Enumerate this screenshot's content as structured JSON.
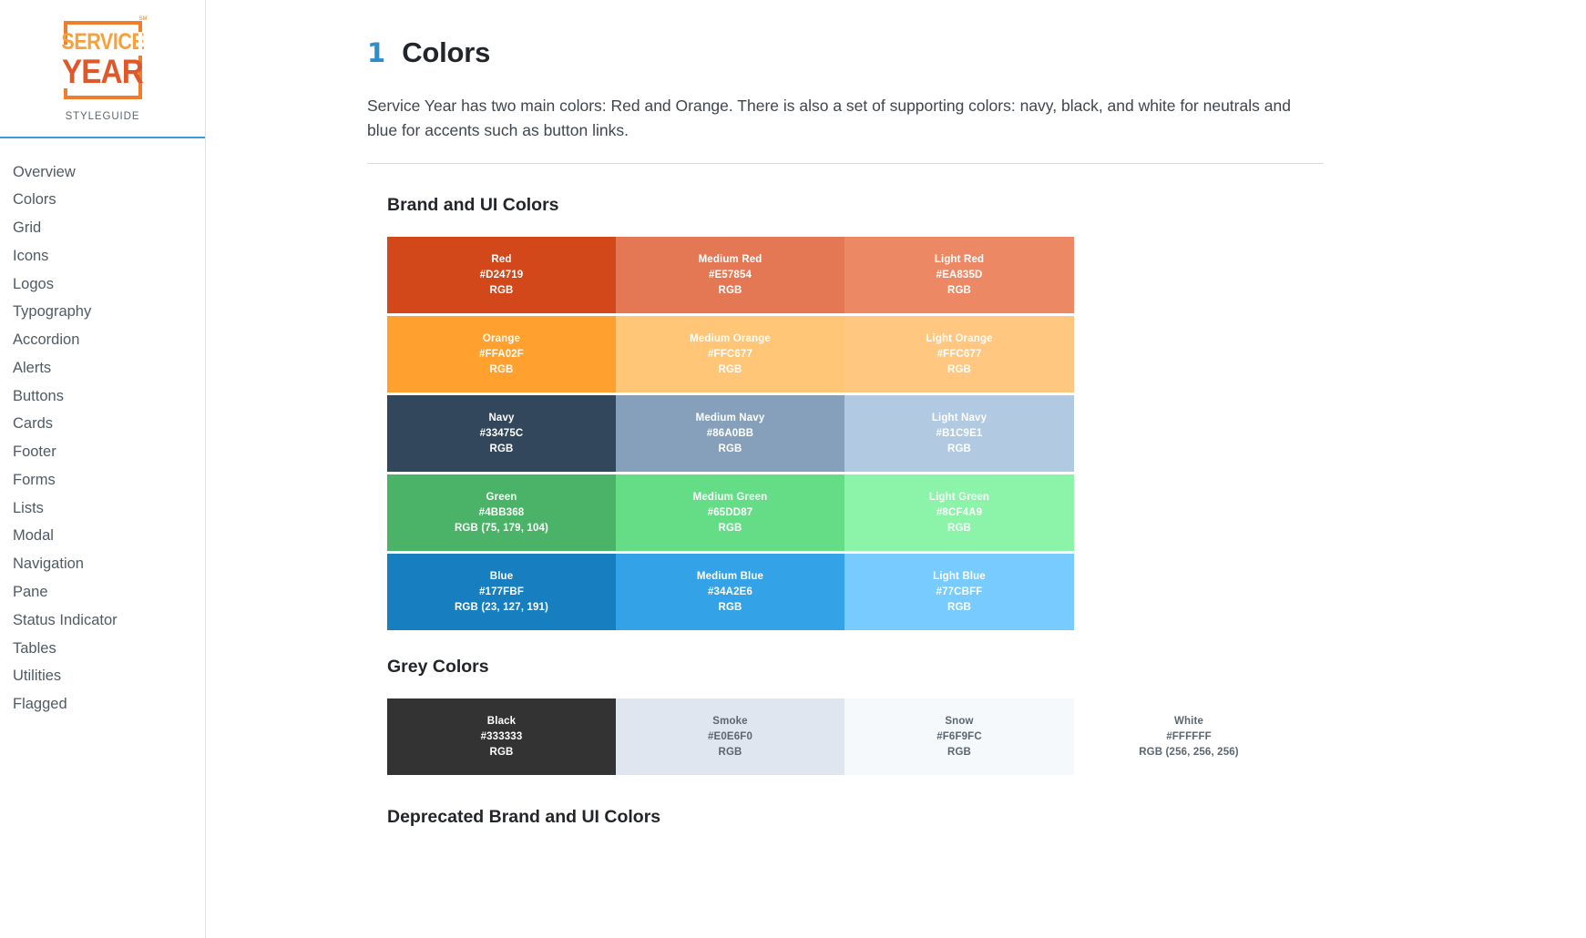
{
  "sidebar": {
    "logo": {
      "word1": "SERVICE",
      "word2": "YEAR",
      "trademark": "SM",
      "caption": "STYLEGUIDE"
    },
    "items": [
      {
        "label": "Overview"
      },
      {
        "label": "Colors"
      },
      {
        "label": "Grid"
      },
      {
        "label": "Icons"
      },
      {
        "label": "Logos"
      },
      {
        "label": "Typography"
      },
      {
        "label": "Accordion"
      },
      {
        "label": "Alerts"
      },
      {
        "label": "Buttons"
      },
      {
        "label": "Cards"
      },
      {
        "label": "Footer"
      },
      {
        "label": "Forms"
      },
      {
        "label": "Lists"
      },
      {
        "label": "Modal"
      },
      {
        "label": "Navigation"
      },
      {
        "label": "Pane"
      },
      {
        "label": "Status Indicator"
      },
      {
        "label": "Tables"
      },
      {
        "label": "Utilities"
      },
      {
        "label": "Flagged"
      }
    ]
  },
  "main": {
    "section_number": "1",
    "title": "Colors",
    "intro": "Service Year has two main colors: Red and Orange. There is also a set of supporting colors: navy, black, and white for neutrals and blue for accents such as button links.",
    "brand_heading": "Brand and UI Colors",
    "grey_heading": "Grey Colors",
    "deprecated_heading": "Deprecated Brand and UI Colors"
  },
  "brand_colors": {
    "rows": [
      {
        "swatches": [
          {
            "name": "Red",
            "hex": "#D24719",
            "rgb": "RGB",
            "bg": "#D2481A",
            "text": "#FFFFFF"
          },
          {
            "name": "Medium Red",
            "hex": "#E57854",
            "rgb": "RGB",
            "bg": "#E57854",
            "text": "#FFFFFF"
          },
          {
            "name": "Light Red",
            "hex": "#EA835D",
            "rgb": "RGB",
            "bg": "#EC8964",
            "text": "#FFFFFF"
          }
        ]
      },
      {
        "swatches": [
          {
            "name": "Orange",
            "hex": "#FFA02F",
            "rgb": "RGB",
            "bg": "#FFA02F",
            "text": "#FFFFFF"
          },
          {
            "name": "Medium Orange",
            "hex": "#FFC677",
            "rgb": "RGB",
            "bg": "#FFC677",
            "text": "#FFFFFF"
          },
          {
            "name": "Light Orange",
            "hex": "#FFC677",
            "rgb": "RGB",
            "bg": "#FFC780",
            "text": "#FFFFFF"
          }
        ]
      },
      {
        "swatches": [
          {
            "name": "Navy",
            "hex": "#33475C",
            "rgb": "RGB",
            "bg": "#33475C",
            "text": "#FFFFFF"
          },
          {
            "name": "Medium Navy",
            "hex": "#86A0BB",
            "rgb": "RGB",
            "bg": "#86A0BB",
            "text": "#FFFFFF"
          },
          {
            "name": "Light Navy",
            "hex": "#B1C9E1",
            "rgb": "RGB",
            "bg": "#B1C9E1",
            "text": "#FFFFFF"
          }
        ]
      },
      {
        "swatches": [
          {
            "name": "Green",
            "hex": "#4BB368",
            "rgb": "RGB (75, 179, 104)",
            "bg": "#4BB368",
            "text": "#FFFFFF"
          },
          {
            "name": "Medium Green",
            "hex": "#65DD87",
            "rgb": "RGB",
            "bg": "#65DD87",
            "text": "#FFFFFF"
          },
          {
            "name": "Light Green",
            "hex": "#8CF4A9",
            "rgb": "RGB",
            "bg": "#8CF4A9",
            "text": "#FFFFFF"
          }
        ]
      },
      {
        "swatches": [
          {
            "name": "Blue",
            "hex": "#177FBF",
            "rgb": "RGB (23, 127, 191)",
            "bg": "#177FBF",
            "text": "#FFFFFF"
          },
          {
            "name": "Medium Blue",
            "hex": "#34A2E6",
            "rgb": "RGB",
            "bg": "#34A2E6",
            "text": "#FFFFFF"
          },
          {
            "name": "Light Blue",
            "hex": "#77CBFF",
            "rgb": "RGB",
            "bg": "#77CBFF",
            "text": "#FFFFFF"
          }
        ]
      }
    ]
  },
  "grey_colors": {
    "swatches": [
      {
        "name": "Black",
        "hex": "#333333",
        "rgb": "RGB",
        "bg": "#333333",
        "text": "#FFFFFF"
      },
      {
        "name": "Smoke",
        "hex": "#E0E6F0",
        "rgb": "RGB",
        "bg": "#E0E6F0",
        "text": "#5b6670"
      },
      {
        "name": "Snow",
        "hex": "#F6F9FC",
        "rgb": "RGB",
        "bg": "#F6F9FC",
        "text": "#5b6670"
      },
      {
        "name": "White",
        "hex": "#FFFFFF",
        "rgb": "RGB (256, 256, 256)",
        "bg": "#FFFFFF",
        "text": "#5b6670"
      }
    ]
  }
}
